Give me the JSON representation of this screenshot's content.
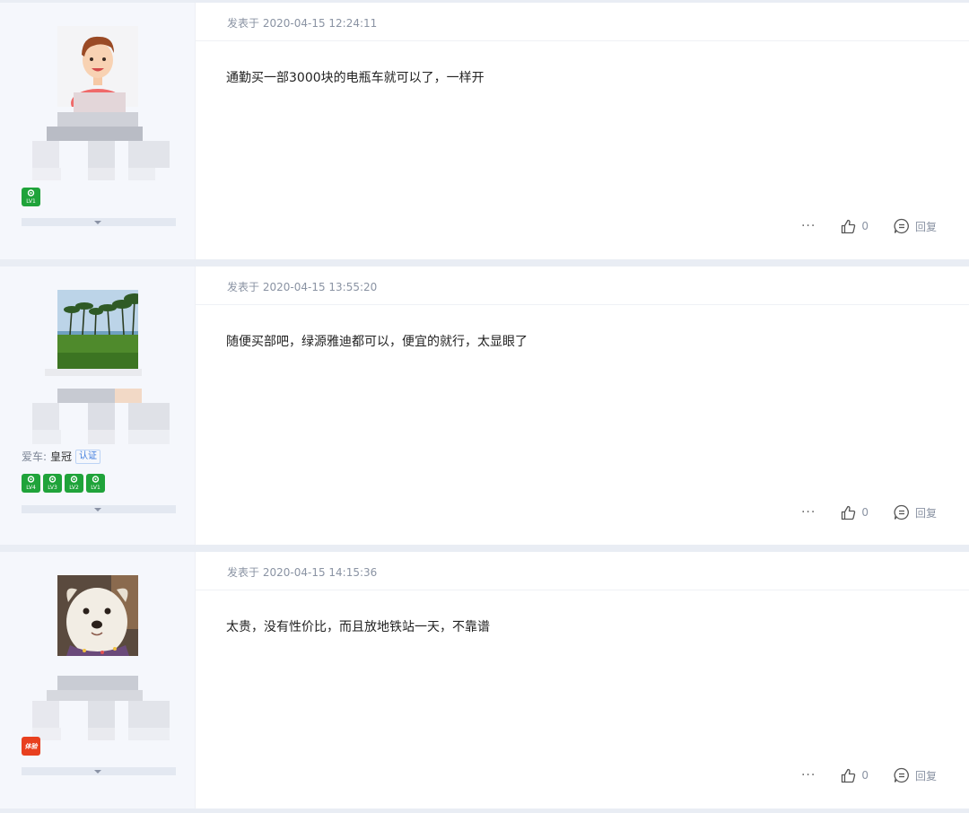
{
  "posts": [
    {
      "time_prefix": "发表于",
      "time": "2020-04-15 12:24:11",
      "content": "通勤买一部3000块的电瓶车就可以了，一样开",
      "likes": "0",
      "reply_label": "回复",
      "more": "···",
      "badges": [
        {
          "level": "LV1"
        }
      ]
    },
    {
      "time_prefix": "发表于",
      "time": "2020-04-15 13:55:20",
      "content": "随便买部吧，绿源雅迪都可以，便宜的就行，太显眼了",
      "likes": "0",
      "reply_label": "回复",
      "more": "···",
      "car_label": "爱车:",
      "car_name": "皇冠",
      "cert_label": "认证",
      "badges": [
        {
          "level": "LV4"
        },
        {
          "level": "LV3"
        },
        {
          "level": "LV2"
        },
        {
          "level": "LV1"
        }
      ]
    },
    {
      "time_prefix": "发表于",
      "time": "2020-04-15 14:15:36",
      "content": "太贵，没有性价比，而且放地铁站一天，不靠谱",
      "likes": "0",
      "reply_label": "回复",
      "more": "···",
      "badges": [
        {
          "level": "体验"
        }
      ]
    }
  ],
  "colors": {
    "accent": "#1fa33a",
    "page_bg": "#e9edf4",
    "side_bg": "#f5f7fc"
  },
  "icons": {
    "like": "thumbs-up-icon",
    "reply": "chat-bubble-icon",
    "expand": "caret-down-icon"
  }
}
